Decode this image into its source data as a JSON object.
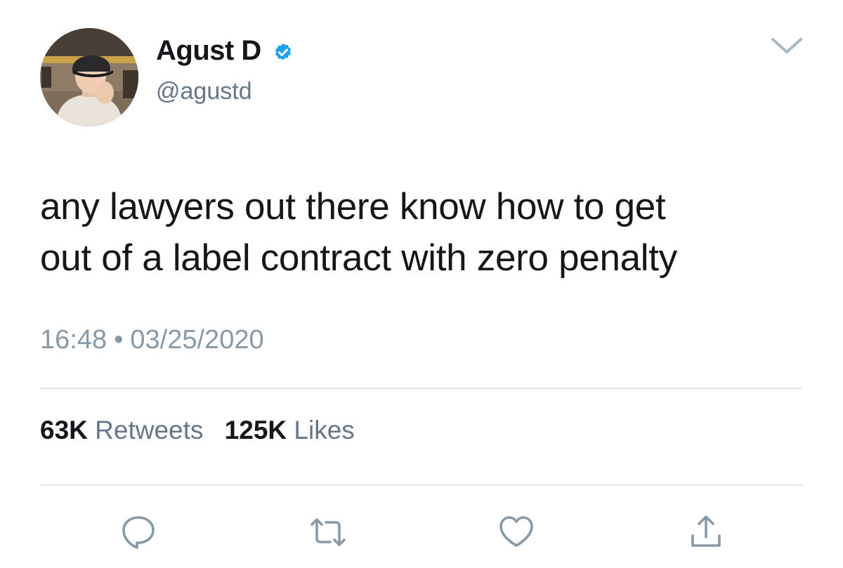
{
  "tweet": {
    "author": {
      "name": "Agust D",
      "handle": "@agustd",
      "verified": true,
      "verified_color": "#1da1f2"
    },
    "text_lines": [
      "any lawyers out there know how to get",
      "out of a label contract with zero penalty"
    ],
    "time": "16:48",
    "separator": "•",
    "date": "03/25/2020",
    "stats": {
      "retweets_count": "63K",
      "retweets_label": "Retweets",
      "likes_count": "125K",
      "likes_label": "Likes"
    },
    "actions": [
      {
        "icon": "reply-icon"
      },
      {
        "icon": "retweet-icon"
      },
      {
        "icon": "like-icon"
      },
      {
        "icon": "share-icon"
      }
    ],
    "menu_icon": "chevron-down-icon"
  },
  "colors": {
    "text_primary": "#14171a",
    "text_secondary": "#657786",
    "meta_gray": "#8899a6",
    "divider": "#e1e8ed",
    "icon_gray": "#8899a6"
  }
}
